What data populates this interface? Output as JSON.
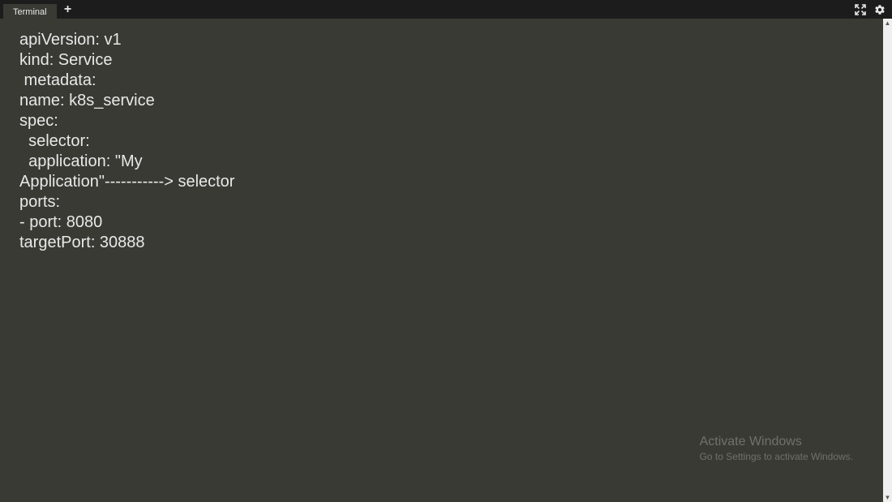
{
  "titlebar": {
    "tab_label": "Terminal",
    "new_tab_glyph": "+",
    "fullscreen_icon": "fullscreen-icon",
    "settings_icon": "gear-icon"
  },
  "terminal": {
    "lines": [
      "apiVersion: v1",
      "kind: Service",
      " metadata:",
      "name: k8s_service",
      "spec:",
      "  selector:",
      "  application: \"My",
      "Application\"-----------> selector",
      "ports:",
      "- port: 8080",
      "targetPort: 30888"
    ]
  },
  "scrollbar": {
    "up_glyph": "▲",
    "down_glyph": "▼"
  },
  "watermark": {
    "title": "Activate Windows",
    "subtitle": "Go to Settings to activate Windows."
  }
}
